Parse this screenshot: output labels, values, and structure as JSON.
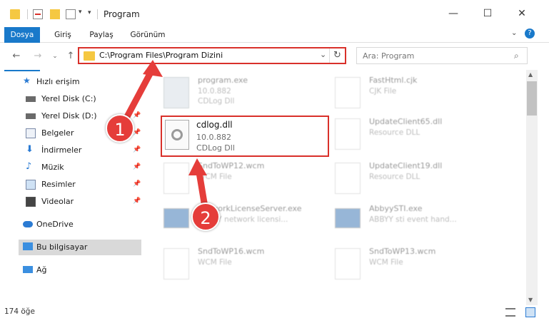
{
  "window": {
    "title": "Program"
  },
  "ribbon": {
    "tabs": [
      "Dosya",
      "Giriş",
      "Paylaş",
      "Görünüm"
    ]
  },
  "address": {
    "path": "C:\\Program Files\\Program Dizini",
    "search_placeholder": "Ara: Program"
  },
  "sidebar": {
    "items": [
      {
        "label": "Hızlı erişim"
      },
      {
        "label": "Yerel Disk (C:)"
      },
      {
        "label": "Yerel Disk (D:)"
      },
      {
        "label": "Belgeler"
      },
      {
        "label": "İndirmeler"
      },
      {
        "label": "Müzik"
      },
      {
        "label": "Resimler"
      },
      {
        "label": "Videolar"
      },
      {
        "label": "OneDrive"
      },
      {
        "label": "Bu bilgisayar"
      },
      {
        "label": "Ağ"
      }
    ]
  },
  "files": [
    {
      "name": "program.exe",
      "line2": "10.0.882",
      "line3": "CDLog Dll"
    },
    {
      "name": "FastHtml.cjk",
      "line2": "CJK File",
      "line3": ""
    },
    {
      "name": "cdlog.dll",
      "line2": "10.0.882",
      "line3": "CDLog Dll"
    },
    {
      "name": "UpdateClient65.dll",
      "line2": "Resource DLL",
      "line3": ""
    },
    {
      "name": "SndToWP12.wcm",
      "line2": "WCM File",
      "line3": ""
    },
    {
      "name": "UpdateClient19.dll",
      "line2": "Resource DLL",
      "line3": ""
    },
    {
      "name": "NetworkLicenseServer.exe",
      "line2": "ABBYY network licensi...",
      "line3": ""
    },
    {
      "name": "AbbyySTI.exe",
      "line2": "ABBYY sti event hand...",
      "line3": ""
    },
    {
      "name": "SndToWP16.wcm",
      "line2": "WCM File",
      "line3": ""
    },
    {
      "name": "SndToWP13.wcm",
      "line2": "WCM File",
      "line3": ""
    }
  ],
  "status": {
    "count": "174 öğe"
  },
  "annotations": {
    "step1": "1",
    "step2": "2",
    "color": "#e53d3a"
  }
}
